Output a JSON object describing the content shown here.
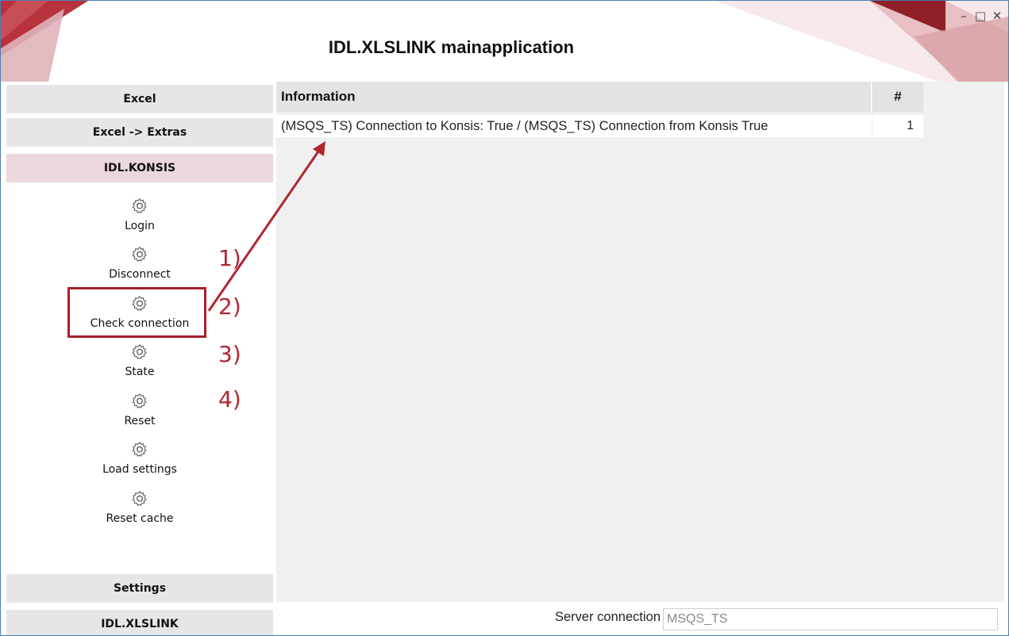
{
  "window": {
    "title": "IDL.XLSLINK mainapplication",
    "controls": {
      "minimize": "–",
      "maximize": "□",
      "close": "✕"
    }
  },
  "sidebar": {
    "nav": [
      "Excel",
      "Excel -> Extras",
      "IDL.KONSIS",
      "Settings",
      "IDL.XLSLINK"
    ],
    "active": "IDL.KONSIS",
    "items": [
      {
        "label": "Login",
        "icon": "gear-icon"
      },
      {
        "label": "Disconnect",
        "icon": "gear-icon"
      },
      {
        "label": "Check connection",
        "icon": "gear-icon"
      },
      {
        "label": "State",
        "icon": "gear-icon"
      },
      {
        "label": "Reset",
        "icon": "gear-icon"
      },
      {
        "label": "Load settings",
        "icon": "gear-icon"
      },
      {
        "label": "Reset cache",
        "icon": "gear-icon"
      }
    ]
  },
  "table": {
    "columns": [
      "Information",
      "#"
    ],
    "rows": [
      [
        "(MSQS_TS) Connection to Konsis: True / (MSQS_TS) Connection from Konsis True",
        "1"
      ]
    ]
  },
  "status": {
    "server_label": "Server connection",
    "server_value": "MSQS_TS"
  },
  "annotations": [
    "1)",
    "2)",
    "3)",
    "4)"
  ],
  "colors": {
    "accent": "#a8202b",
    "active_nav": "#ecd7dc",
    "nav_bg": "#e6e6e6"
  }
}
